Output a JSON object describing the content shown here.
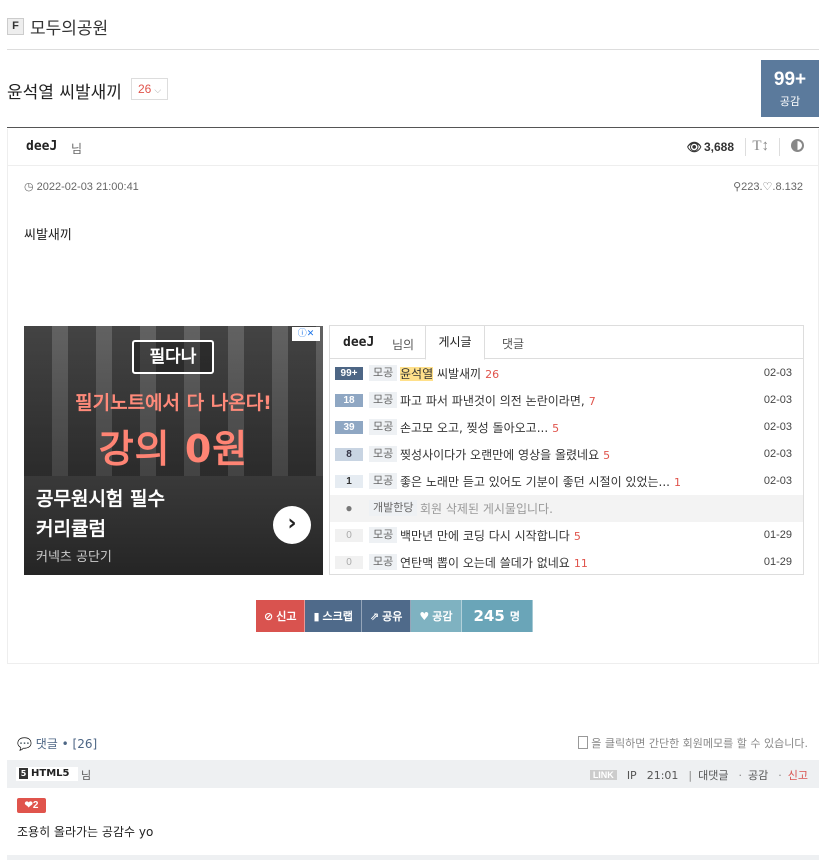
{
  "board": {
    "badge": "F",
    "name": "모두의공원"
  },
  "post": {
    "title": "윤석열 씨발새끼",
    "comment_count": "26",
    "like_count": "99+",
    "like_label": "공감",
    "author": "deeJ",
    "author_suffix": "님",
    "views": "3,688",
    "date": "2022-02-03 21:00:41",
    "ip": "223.♡.8.132",
    "content": "씨발새끼"
  },
  "ad": {
    "info": "ⓘ✕",
    "brand": "필다나",
    "line1": "필기노트에서 다 나온다!",
    "line2": "강의 0원",
    "headline1": "공무원시험 필수",
    "headline2": "커리큘럼",
    "sub": "커넥츠 공단기"
  },
  "user_posts": {
    "user": "deeJ",
    "user_suffix": "님의",
    "tab_posts": "게시글",
    "tab_comments": "댓글",
    "items": [
      {
        "count": "99+",
        "board": "모공",
        "title_hl": "윤석열",
        "title": " 씨발새끼",
        "comments": "26",
        "date": "02-03"
      },
      {
        "count": "18",
        "board": "모공",
        "title_hl": "",
        "title": "파고 파서 파낸것이 의전 논란이라면,",
        "comments": "7",
        "date": "02-03"
      },
      {
        "count": "39",
        "board": "모공",
        "title_hl": "",
        "title": "손고모 오고, 찢성 돌아오고...",
        "comments": "5",
        "date": "02-03"
      },
      {
        "count": "8",
        "board": "모공",
        "title_hl": "",
        "title": "찢성사이다가 오랜만에 영상을 올렸네요",
        "comments": "5",
        "date": "02-03"
      },
      {
        "count": "1",
        "board": "모공",
        "title_hl": "",
        "title": "좋은 노래만 듣고 있어도 기분이 좋던 시절이 있었는...",
        "comments": "1",
        "date": "02-03"
      },
      {
        "count": "!",
        "board": "개발한당",
        "title_hl": "",
        "title": "회원 삭제된 게시물입니다.",
        "comments": "",
        "date": ""
      },
      {
        "count": "0",
        "board": "모공",
        "title_hl": "",
        "title": "백만년 만에 코딩 다시 시작합니다",
        "comments": "5",
        "date": "01-29"
      },
      {
        "count": "0",
        "board": "모공",
        "title_hl": "",
        "title": "연탄맥 뽑이 오는데 쓸데가 없네요",
        "comments": "11",
        "date": "01-29"
      }
    ]
  },
  "actions": {
    "report": "신고",
    "scrap": "스크랩",
    "share": "공유",
    "like": "공감",
    "like_count": "245",
    "like_unit": "명"
  },
  "comments": {
    "header_label": "댓글 • [26]",
    "memo_hint": "을 클릭하면 간단한 회원메모를 할 수 있습니다.",
    "first": {
      "badge": "HTML5",
      "suffix": "님",
      "link_label": "LINK",
      "ip": "IP",
      "time": "21:01",
      "reply": "대댓글",
      "like": "공감",
      "report": "신고",
      "heart": "❤2",
      "text": "조용히 올라가는 공감수 yo"
    }
  }
}
